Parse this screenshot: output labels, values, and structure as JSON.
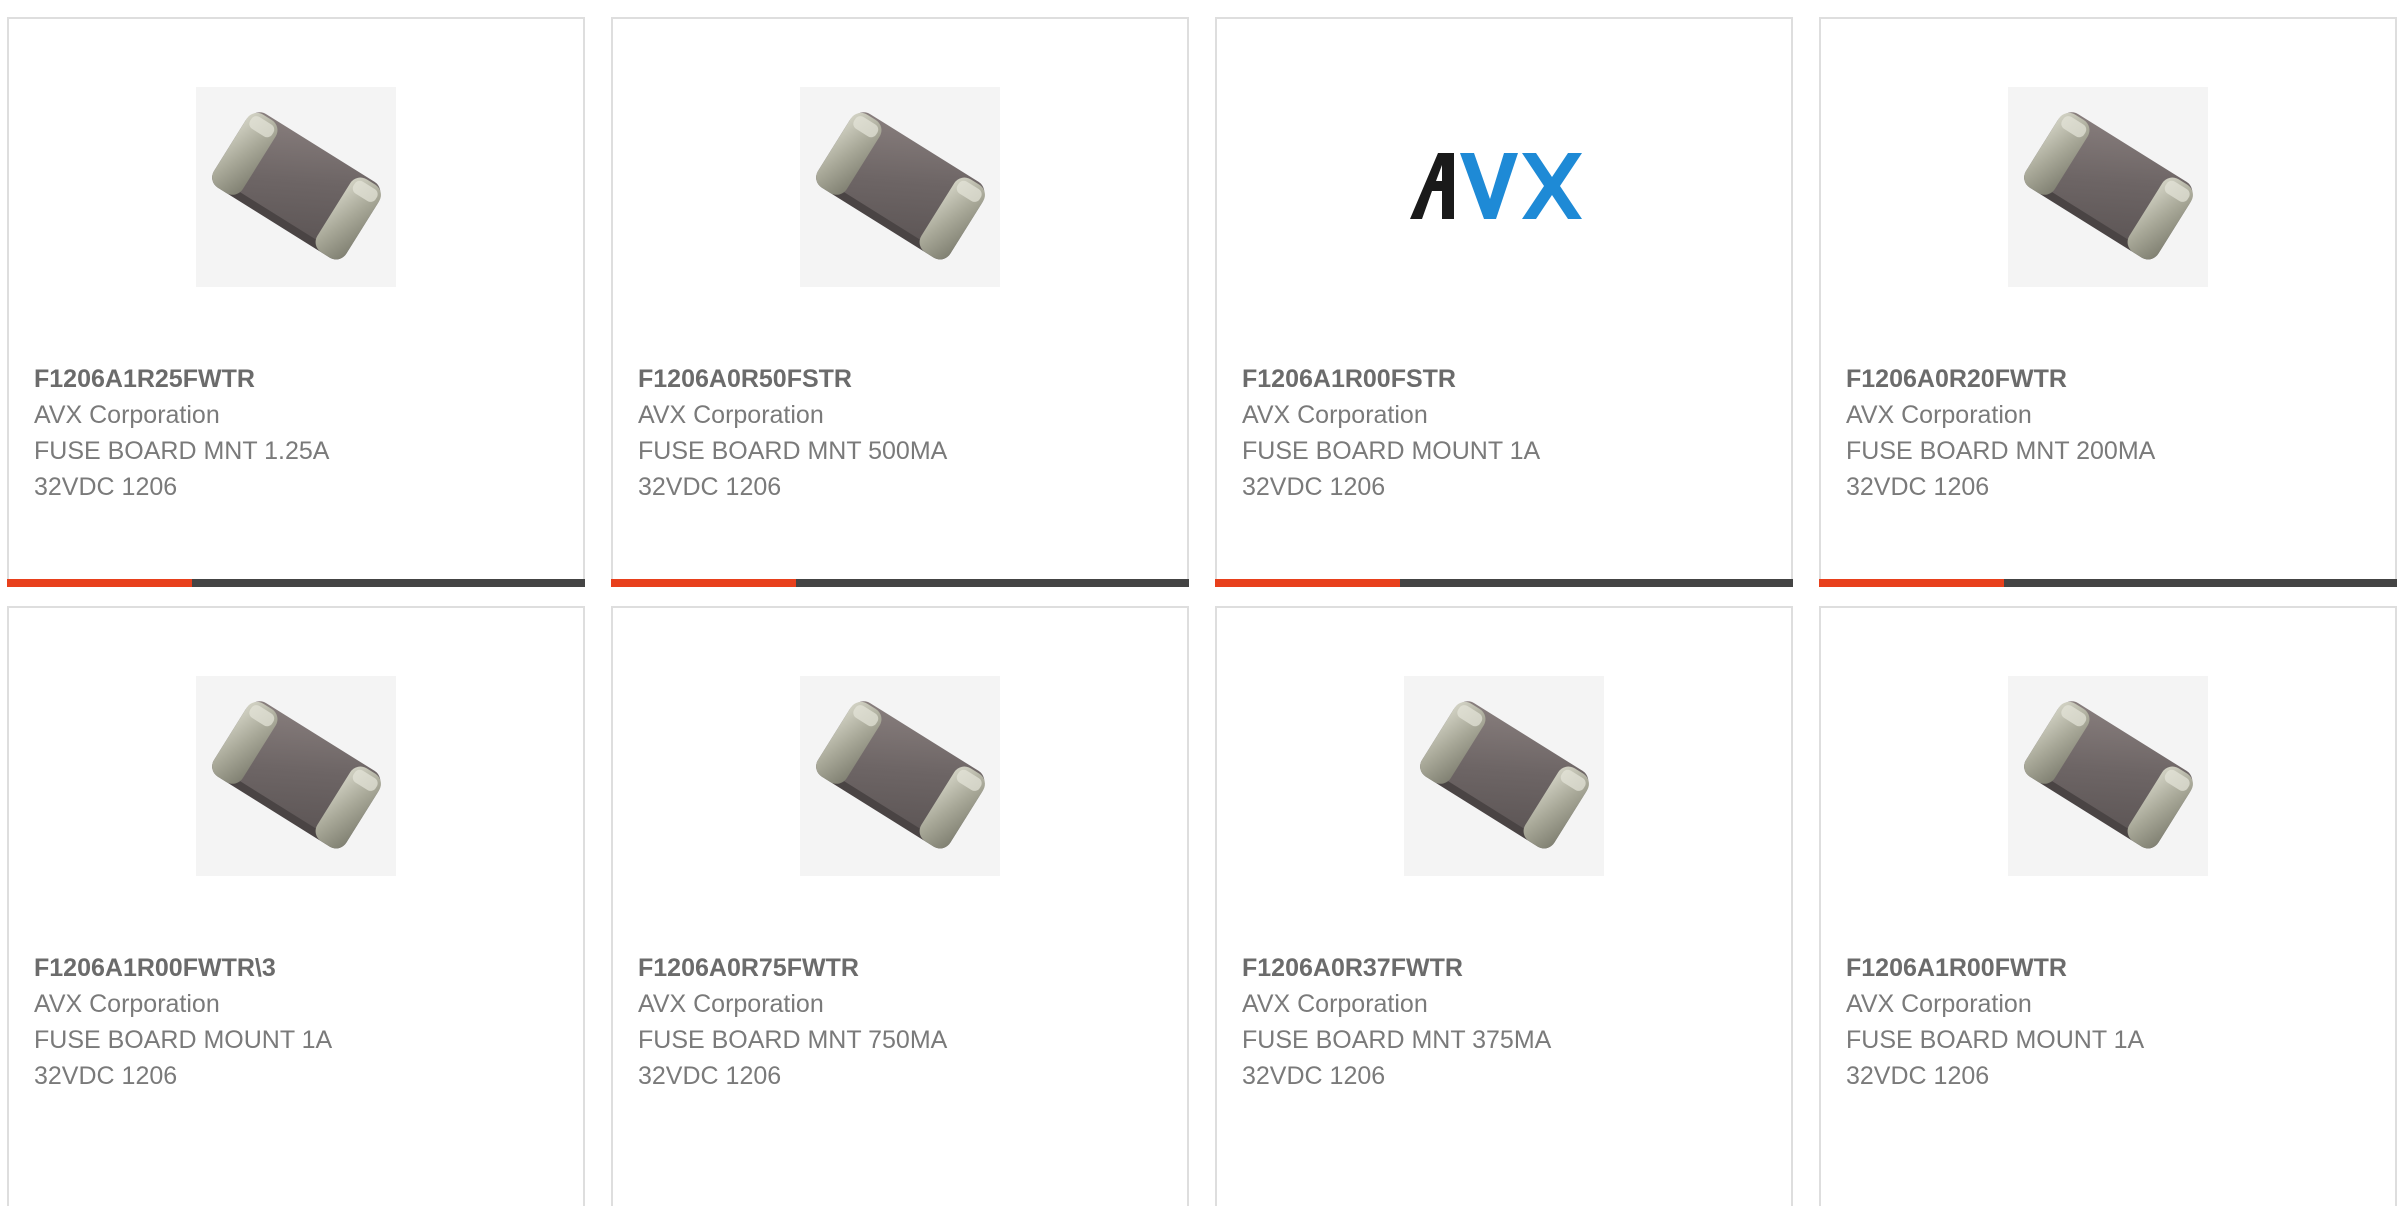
{
  "colors": {
    "accent": "#e8401c",
    "bar_dark": "#444444",
    "card_border": "#dedede",
    "text": "#7a7a7a",
    "avx_logo_dark": "#1a1a1a",
    "avx_logo_blue": "#1e8ad6"
  },
  "products": [
    {
      "part": "F1206A1R25FWTR",
      "manufacturer": "AVX Corporation",
      "description": "FUSE BOARD MNT 1.25A 32VDC 1206",
      "image": "chip-fuse-image",
      "progress": 0.32
    },
    {
      "part": "F1206A0R50FSTR",
      "manufacturer": "AVX Corporation",
      "description": "FUSE BOARD MNT 500MA 32VDC 1206",
      "image": "chip-fuse-image",
      "progress": 0.32
    },
    {
      "part": "F1206A1R00FSTR",
      "manufacturer": "AVX Corporation",
      "description": "FUSE BOARD MOUNT 1A 32VDC 1206",
      "image": "avx-logo",
      "logo_text": "AVX",
      "progress": 0.32
    },
    {
      "part": "F1206A0R20FWTR",
      "manufacturer": "AVX Corporation",
      "description": "FUSE BOARD MNT 200MA 32VDC 1206",
      "image": "chip-fuse-image",
      "progress": 0.32
    },
    {
      "part": "F1206A1R00FWTR\\3",
      "manufacturer": "AVX Corporation",
      "description": "FUSE BOARD MOUNT 1A 32VDC 1206",
      "image": "chip-fuse-image"
    },
    {
      "part": "F1206A0R75FWTR",
      "manufacturer": "AVX Corporation",
      "description": "FUSE BOARD MNT 750MA 32VDC 1206",
      "image": "chip-fuse-image"
    },
    {
      "part": "F1206A0R37FWTR",
      "manufacturer": "AVX Corporation",
      "description": "FUSE BOARD MNT 375MA 32VDC 1206",
      "image": "chip-fuse-image"
    },
    {
      "part": "F1206A1R00FWTR",
      "manufacturer": "AVX Corporation",
      "description": "FUSE BOARD MOUNT 1A 32VDC 1206",
      "image": "chip-fuse-image"
    }
  ]
}
